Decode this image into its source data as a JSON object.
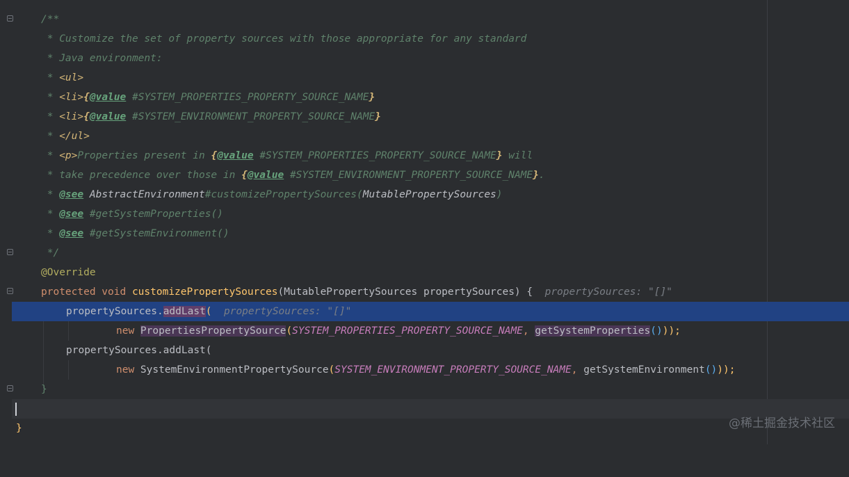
{
  "editor": {
    "lines": {
      "l1": "/**",
      "l2": " * Customize the set of property sources with those appropriate for any standard",
      "l3": " * Java environment:",
      "l4_prefix": " * ",
      "l4_tag": "<ul>",
      "l5_prefix": " * ",
      "l5_tag": "<li>",
      "l5_brace_open": "{",
      "l5_value": "@value",
      "l5_ref": " #SYSTEM_PROPERTIES_PROPERTY_SOURCE_NAME",
      "l5_brace_close": "}",
      "l6_prefix": " * ",
      "l6_tag": "<li>",
      "l6_brace_open": "{",
      "l6_value": "@value",
      "l6_ref": " #SYSTEM_ENVIRONMENT_PROPERTY_SOURCE_NAME",
      "l6_brace_close": "}",
      "l7_prefix": " * ",
      "l7_tag": "</ul>",
      "l8_prefix": " * ",
      "l8_tag": "<p>",
      "l8_text": "Properties present in ",
      "l8_brace_open": "{",
      "l8_value": "@value",
      "l8_ref": " #SYSTEM_PROPERTIES_PROPERTY_SOURCE_NAME",
      "l8_brace_close": "}",
      "l8_tail": " will",
      "l9_text": " * take precedence over those in ",
      "l9_brace_open": "{",
      "l9_value": "@value",
      "l9_ref": " #SYSTEM_ENVIRONMENT_PROPERTY_SOURCE_NAME",
      "l9_brace_close": "}",
      "l9_tail": ".",
      "l10_prefix": " * ",
      "l10_see": "@see",
      "l10_space": " ",
      "l10_class": "AbstractEnvironment",
      "l10_method": "#customizePropertySources(",
      "l10_param": "MutablePropertySources",
      "l10_close": ")",
      "l11_prefix": " * ",
      "l11_see": "@see",
      "l11_ref": " #getSystemProperties()",
      "l12_prefix": " * ",
      "l12_see": "@see",
      "l12_ref": " #getSystemEnvironment()",
      "l13": " */",
      "l14": "@Override",
      "l15_kw": "protected void ",
      "l15_fn": "customizePropertySources",
      "l15_rest": "(MutablePropertySources propertySources) { ",
      "l15_hint": " propertySources: \"[]\"",
      "l16_obj": "propertySources.",
      "l16_fn": "addLast",
      "l16_paren": "(",
      "l16_hint": "  propertySources: \"[]\"",
      "l17_kw": "new ",
      "l17_class": "PropertiesPropertySource",
      "l17_paren": "(",
      "l17_const": "SYSTEM_PROPERTIES_PROPERTY_SOURCE_NAME",
      "l17_comma": ", ",
      "l17_call": "getSystemProperties",
      "l17_close_inner": "()",
      "l17_close_outer": ")",
      "l17_end": ");",
      "l18": "propertySources.addLast(",
      "l19_kw": "new ",
      "l19_class": "SystemEnvironmentPropertySource",
      "l19_paren": "(",
      "l19_const": "SYSTEM_ENVIRONMENT_PROPERTY_SOURCE_NAME",
      "l19_comma": ", ",
      "l19_call": "getSystemEnvironment",
      "l19_close_inner": "()",
      "l19_close_outer": ")",
      "l19_end": ");",
      "l20": "}",
      "l22": "}"
    }
  },
  "watermark": "@稀土掘金技术社区",
  "colors": {
    "background": "#2b2d30",
    "doc_comment": "#5f826b",
    "keyword": "#cf8e6d",
    "function_decl": "#56a8f5",
    "constant": "#c77dbb",
    "selection_line": "#214283"
  }
}
